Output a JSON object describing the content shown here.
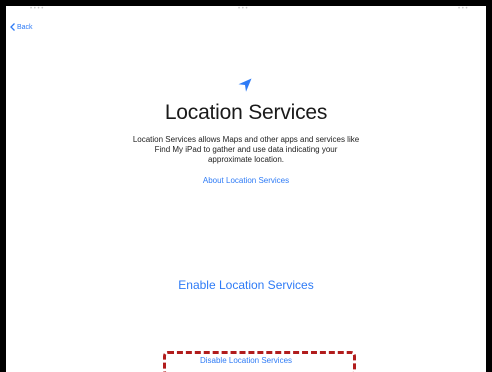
{
  "nav": {
    "back_label": "Back"
  },
  "icon": {
    "name": "location-arrow-icon",
    "color": "#2e7bf6"
  },
  "title": "Location Services",
  "description": "Location Services allows Maps and other apps and services like Find My iPad to gather and use data indicating your approximate location.",
  "about_link": "About Location Services",
  "enable_button": "Enable Location Services",
  "disable_button": "Disable Location Services",
  "colors": {
    "accent": "#2e7bf6",
    "highlight": "#b11c1c",
    "frame": "#000000"
  }
}
